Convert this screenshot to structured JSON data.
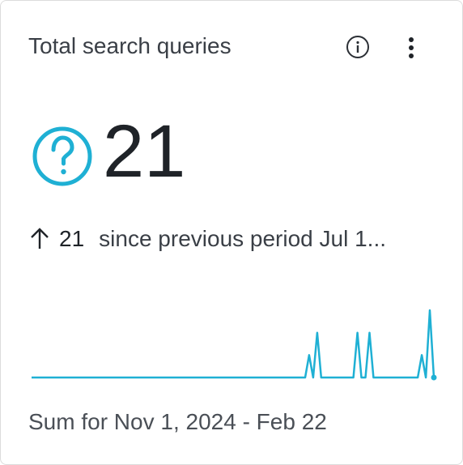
{
  "card": {
    "title": "Total search queries",
    "value": "21",
    "delta": {
      "direction": "up",
      "value": "21",
      "text": "since previous period Jul 1..."
    },
    "footer": "Sum for Nov 1, 2024 - Feb 22"
  },
  "icons": {
    "info": "info-icon",
    "more": "more-vertical-icon",
    "metric": "question-circle-icon",
    "delta": "arrow-up-icon"
  },
  "colors": {
    "accent": "#1fb0d4",
    "text_primary": "#1f2328",
    "text_secondary": "#3a3f46"
  },
  "chart_data": {
    "type": "line",
    "title": "",
    "xlabel": "",
    "ylabel": "",
    "y": [
      0,
      0,
      0,
      0,
      0,
      0,
      0,
      0,
      0,
      0,
      0,
      0,
      0,
      0,
      0,
      0,
      0,
      0,
      0,
      0,
      0,
      0,
      0,
      0,
      0,
      0,
      0,
      0,
      0,
      0,
      0,
      0,
      0,
      0,
      0,
      0,
      0,
      0,
      0,
      0,
      0,
      0,
      0,
      0,
      0,
      0,
      0,
      0,
      0,
      0,
      0,
      0,
      0,
      0,
      0,
      0,
      0,
      0,
      0,
      0,
      0,
      0,
      0,
      0,
      0,
      0,
      0,
      0,
      0,
      1,
      0,
      2,
      0,
      0,
      0,
      0,
      0,
      0,
      0,
      0,
      0,
      2,
      0,
      0,
      2,
      0,
      0,
      0,
      0,
      0,
      0,
      0,
      0,
      0,
      0,
      0,
      0,
      1,
      0,
      3,
      0
    ],
    "ylim": [
      0,
      3
    ],
    "grid": false
  }
}
